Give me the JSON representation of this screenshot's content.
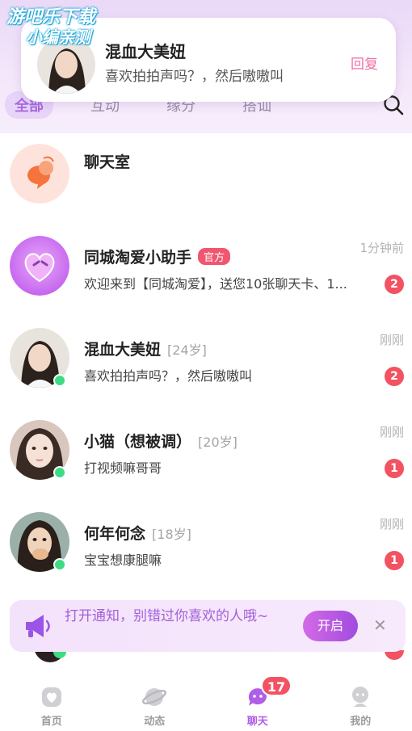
{
  "watermark": {
    "line1": "游吧乐下载",
    "line2": "小编亲测"
  },
  "banner": {
    "name": "混血大美妞",
    "message": "喜欢拍拍声吗？，然后嗷嗷叫",
    "reply_label": "回复"
  },
  "tabs": [
    {
      "label": "全部",
      "active": true
    },
    {
      "label": "互动",
      "active": false
    },
    {
      "label": "缘分",
      "active": false
    },
    {
      "label": "搭讪",
      "active": false
    }
  ],
  "conversations": [
    {
      "name": "聊天室",
      "age": "",
      "tag": "",
      "message": "",
      "time": "",
      "badge": "",
      "online": false
    },
    {
      "name": "同城淘爱小助手",
      "age": "",
      "tag": "官方",
      "message": "欢迎来到【同城淘爱】，送您10张聊天卡、1...",
      "time": "1分钟前",
      "badge": "2",
      "online": false
    },
    {
      "name": "混血大美妞",
      "age": "[24岁]",
      "tag": "",
      "message": "喜欢拍拍声吗？，然后嗷嗷叫",
      "time": "刚刚",
      "badge": "2",
      "online": true
    },
    {
      "name": "小猫（想被调）",
      "age": "[20岁]",
      "tag": "",
      "message": "打视频嘛哥哥",
      "time": "刚刚",
      "badge": "1",
      "online": true
    },
    {
      "name": "何年何念",
      "age": "[18岁]",
      "tag": "",
      "message": "宝宝想康腿嘛",
      "time": "刚刚",
      "badge": "1",
      "online": true
    }
  ],
  "notify_prompt": {
    "text": "打开通知，别错过你喜欢的人哦~",
    "button_label": "开启",
    "close_glyph": "✕"
  },
  "bottom_nav": [
    {
      "label": "首页",
      "icon": "home-icon",
      "active": false
    },
    {
      "label": "动态",
      "icon": "planet-icon",
      "active": false
    },
    {
      "label": "聊天",
      "icon": "chat-icon",
      "active": true,
      "count": "17"
    },
    {
      "label": "我的",
      "icon": "profile-icon",
      "active": false
    }
  ],
  "colors": {
    "accent": "#b05ee6",
    "badge": "#f25262",
    "online": "#3ddc84",
    "reply": "#f06fa4",
    "header_bg": "#ead9f7"
  }
}
